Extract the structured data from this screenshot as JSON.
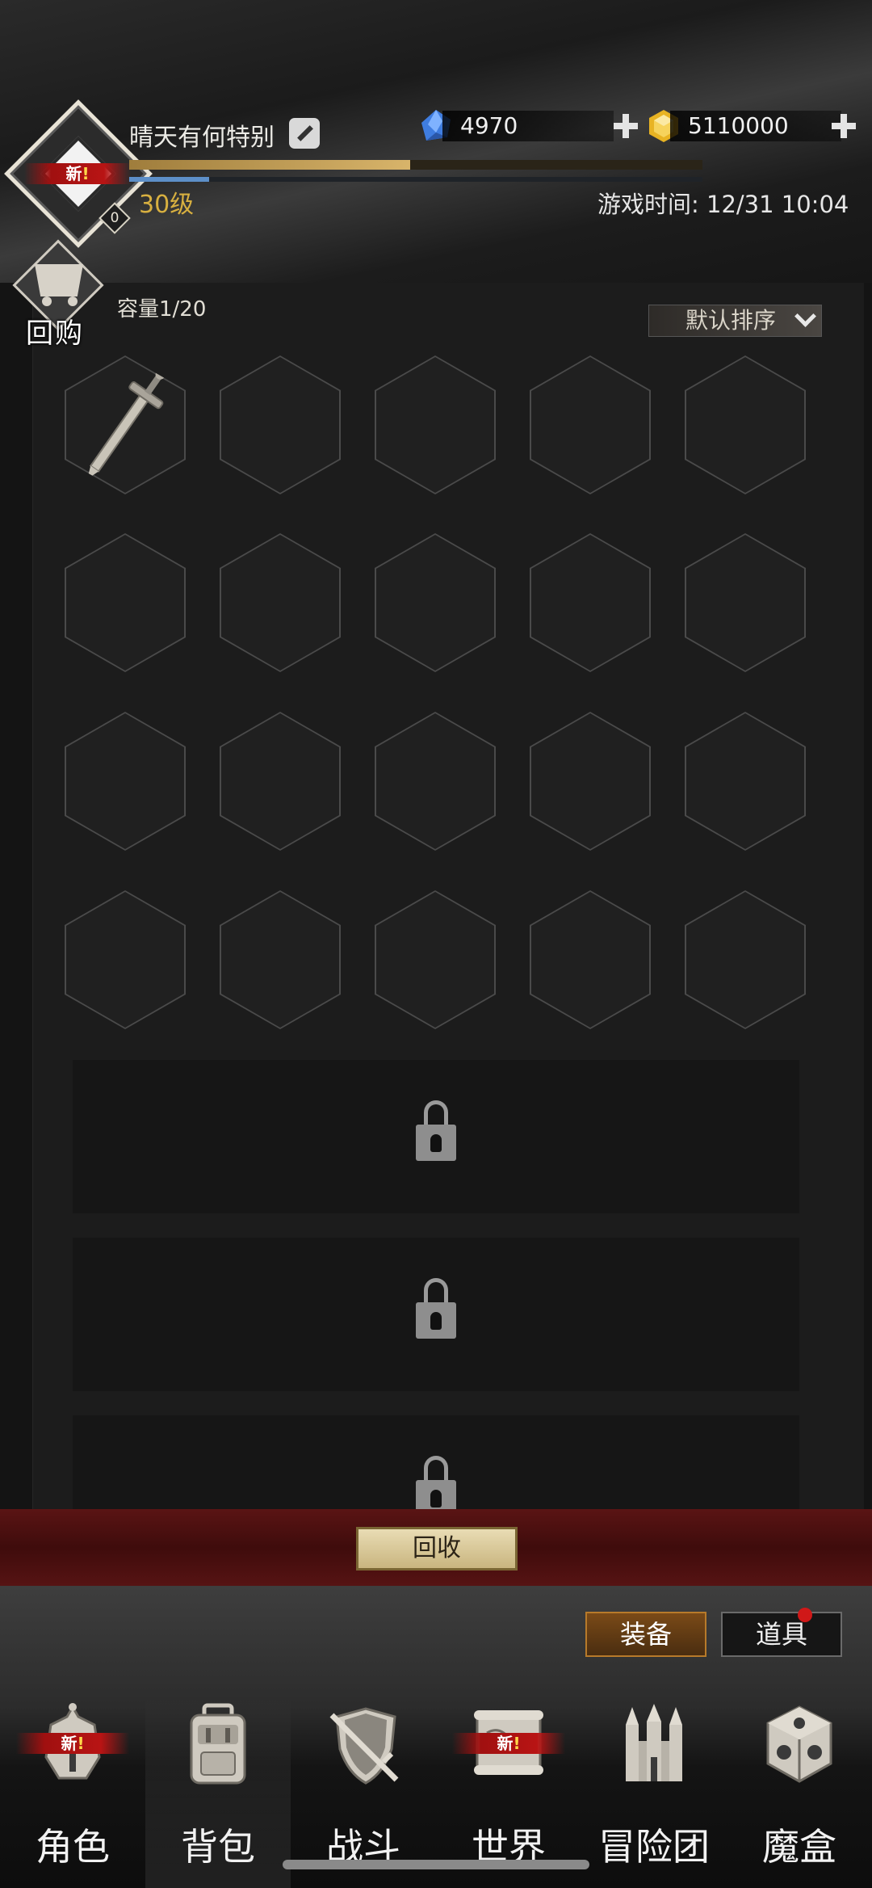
{
  "player": {
    "name": "晴天有何特别",
    "level": "30级",
    "badge_count": "0",
    "new_label": "新",
    "exp_progress": 0.49,
    "mp_progress": 0.14
  },
  "currency": {
    "diamonds": "4970",
    "gold": "5110000"
  },
  "game_time": "游戏时间: 12/31 10:04",
  "inventory": {
    "buyback_label": "回购",
    "capacity": "容量1/20",
    "sort_label": "默认排序",
    "items": [
      "sword"
    ]
  },
  "recycle_label": "回收",
  "tabs": {
    "equip": "装备",
    "items": "道具"
  },
  "nav": {
    "role": "角色",
    "bag": "背包",
    "battle": "战斗",
    "world": "世界",
    "guild": "冒险团",
    "magicbox": "魔盒",
    "active": "背包"
  },
  "colors": {
    "level_gold": "#d8b040",
    "exp_fill": "#d8b46a",
    "mp_fill": "#5d8fc8",
    "new_ribbon": "#b81414",
    "recycle_bar": "#4f1010"
  }
}
